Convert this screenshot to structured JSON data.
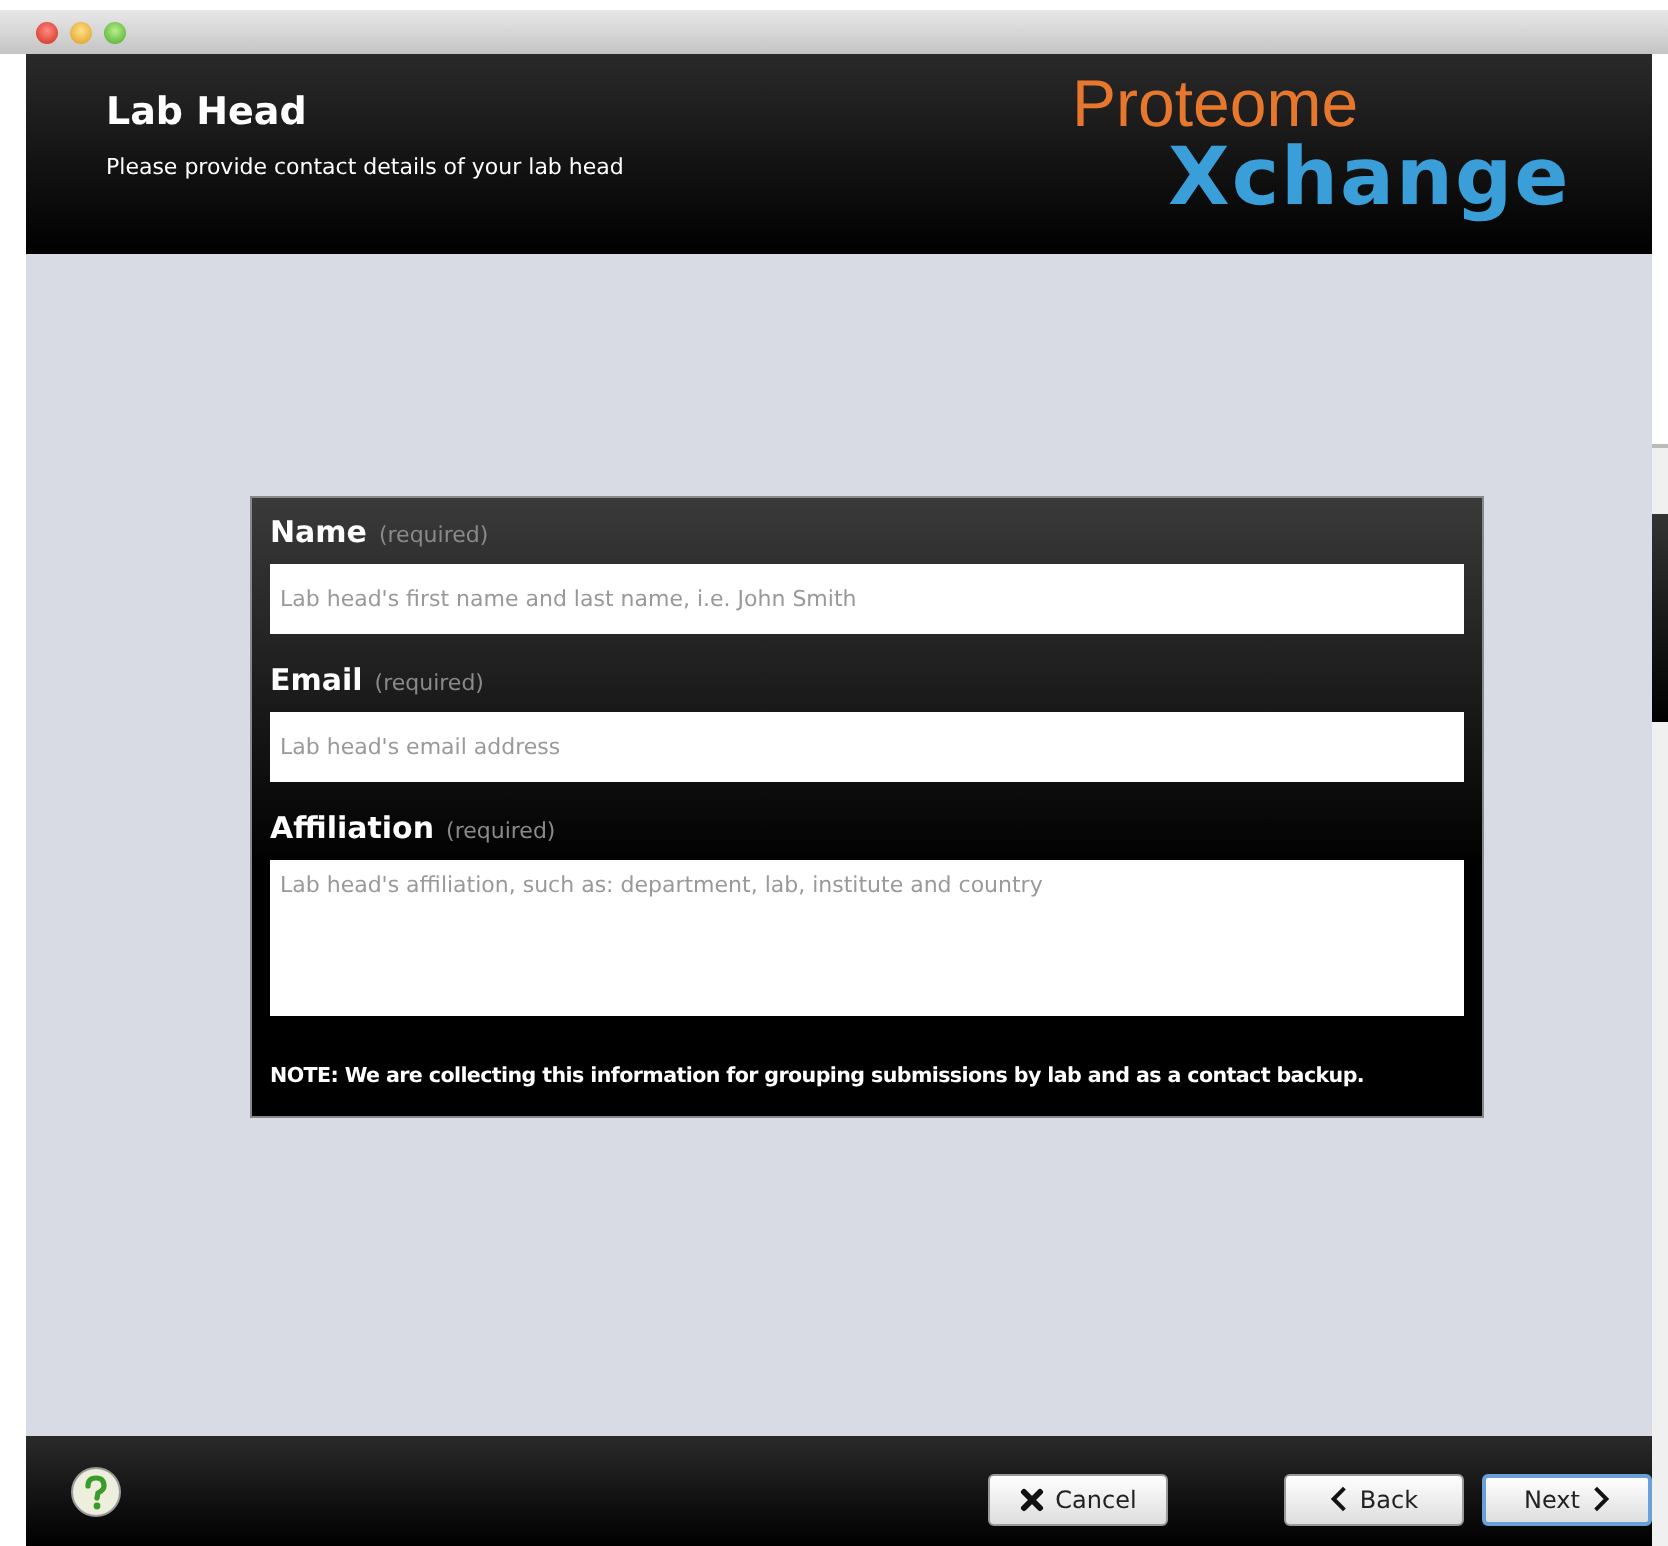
{
  "header": {
    "title": "Lab Head",
    "subtitle": "Please provide contact details of your lab head",
    "logo": {
      "top": "Proteome",
      "bottom": "Xchange"
    }
  },
  "form": {
    "fields": [
      {
        "label": "Name",
        "hint": "(required)",
        "placeholder": "Lab head's first name and last name, i.e. John Smith",
        "kind": "line"
      },
      {
        "label": "Email",
        "hint": "(required)",
        "placeholder": "Lab head's email address",
        "kind": "line"
      },
      {
        "label": "Affiliation",
        "hint": "(required)",
        "placeholder": "Lab head's affiliation, such as: department, lab, institute and country",
        "kind": "area"
      }
    ],
    "note": "NOTE: We are collecting this information for grouping submissions by lab and as a contact backup."
  },
  "footer": {
    "buttons": [
      {
        "label": "Cancel",
        "kind": "cross",
        "default": false
      },
      {
        "label": "Back",
        "kind": "left",
        "default": false
      },
      {
        "label": "Next",
        "kind": "right",
        "default": true
      }
    ]
  }
}
